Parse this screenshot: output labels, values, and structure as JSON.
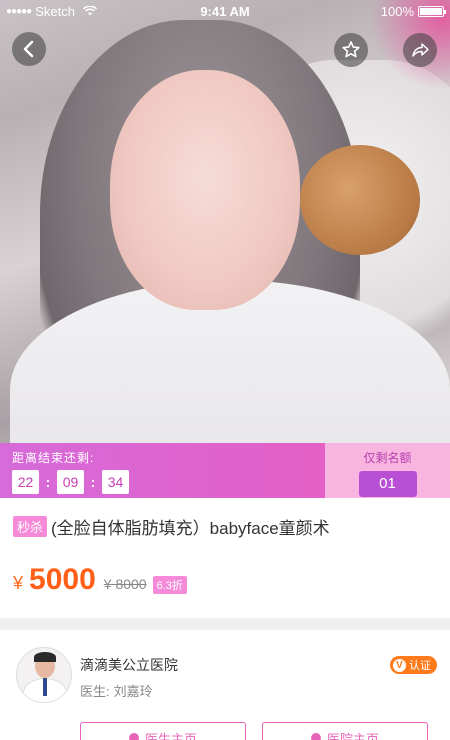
{
  "status_bar": {
    "signal": "●●●●●",
    "carrier": "Sketch",
    "time": "9:41 AM",
    "battery": "100%",
    "battery_level": 1.0
  },
  "hero": {
    "icons": [
      "back-arrow-icon",
      "star-icon",
      "share-icon"
    ]
  },
  "countdown": {
    "label": "距离结束还剩:",
    "hours": "22",
    "minutes": "09",
    "seconds": "34",
    "quota_label": "仅剩名额",
    "quota_count": "01"
  },
  "product": {
    "tag": "秒杀",
    "title": "(全脸自体脂肪填充）babyface童颜术",
    "currency": "¥",
    "price": "5000",
    "original_price": "¥ 8000",
    "discount": "6.3折"
  },
  "hospital": {
    "name": "滴滴美公立医院",
    "doctor_label": "医生:",
    "doctor_name": "刘嘉玲",
    "badge_v": "V",
    "badge_text": "认证",
    "doctor_button": "医生主页",
    "hospital_button": "医院主页"
  },
  "colors": {
    "accent_pink": "#e864b8",
    "price_orange": "#ff5f17",
    "countdown_gradient_start": "#d66bd9",
    "quota_bg": "#f7b5df"
  }
}
